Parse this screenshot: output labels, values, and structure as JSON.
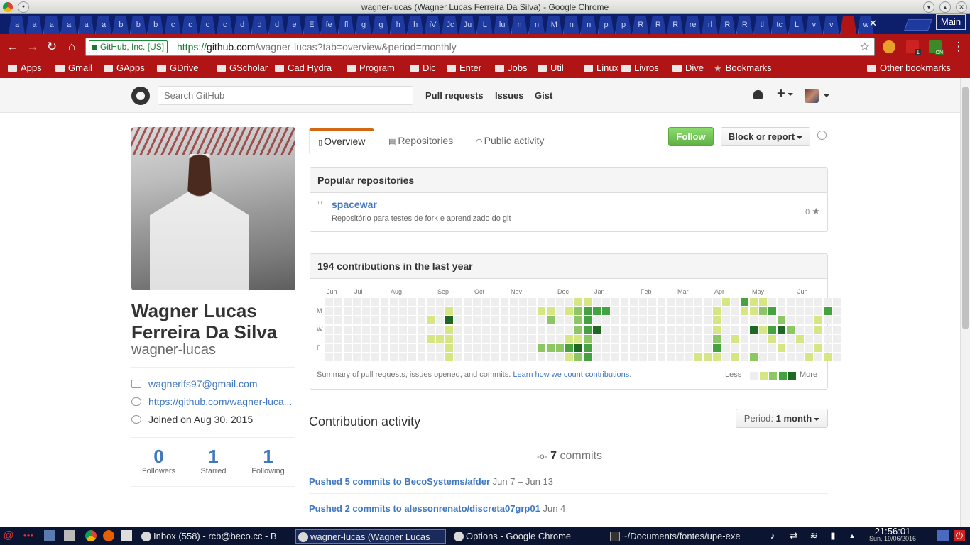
{
  "window": {
    "title": "wagner-lucas (Wagner Lucas Ferreira Da Silva) - Google Chrome",
    "workspace": "Main"
  },
  "tabs": [
    "a",
    "a",
    "a",
    "a",
    "a",
    "a",
    "b",
    "b",
    "b",
    "c",
    "c",
    "c",
    "c",
    "d",
    "d",
    "d",
    "e",
    "E",
    "fe",
    "fl",
    "g",
    "g",
    "h",
    "h",
    "iV",
    "Jc",
    "Ju",
    "L",
    "lu",
    "n",
    "n",
    "M",
    "n",
    "n",
    "p",
    "p",
    "R",
    "R",
    "R",
    "re",
    "rl",
    "R",
    "R",
    "tl",
    "tc",
    "L",
    "v",
    "v",
    "",
    "w"
  ],
  "omnibox": {
    "security_label": "GitHub, Inc. [US]",
    "url_prefix": "https://",
    "url_host": "github.com",
    "url_path": "/wagner-lucas?tab=overview&period=monthly"
  },
  "extensions": {
    "badge1": "1",
    "badge2": "ON"
  },
  "bookmarks": [
    {
      "label": "Apps",
      "icon": "apps-icon"
    },
    {
      "label": "Gmail",
      "icon": "gmail-icon"
    },
    {
      "label": "GApps",
      "icon": "google-icon"
    },
    {
      "label": "GDrive",
      "icon": "drive-icon"
    },
    {
      "label": "GScholar",
      "icon": "scholar-icon"
    },
    {
      "label": "Cad Hydra",
      "icon": "drive-icon"
    },
    {
      "label": "Program",
      "icon": "folder-icon"
    },
    {
      "label": "Dic",
      "icon": "folder-icon"
    },
    {
      "label": "Enter",
      "icon": "folder-icon"
    },
    {
      "label": "Jobs",
      "icon": "folder-icon"
    },
    {
      "label": "Util",
      "icon": "folder-icon"
    },
    {
      "label": "Linux",
      "icon": "folder-icon"
    },
    {
      "label": "Livros",
      "icon": "folder-icon"
    },
    {
      "label": "Dive",
      "icon": "folder-icon"
    },
    {
      "label": "Bookmarks",
      "icon": "star-icon"
    }
  ],
  "other_bookmarks": "Other bookmarks",
  "github": {
    "search_placeholder": "Search GitHub",
    "nav": [
      "Pull requests",
      "Issues",
      "Gist"
    ]
  },
  "profile": {
    "fullname": "Wagner Lucas Ferreira Da Silva",
    "username": "wagner-lucas",
    "email": "wagnerlfs97@gmail.com",
    "website": "https://github.com/wagner-luca...",
    "joined": "Joined on Aug 30, 2015",
    "stats": [
      {
        "value": "0",
        "label": "Followers"
      },
      {
        "value": "1",
        "label": "Starred"
      },
      {
        "value": "1",
        "label": "Following"
      }
    ]
  },
  "profile_tabs": [
    "Overview",
    "Repositories",
    "Public activity"
  ],
  "actions": {
    "follow": "Follow",
    "block": "Block or report"
  },
  "popular": {
    "title": "Popular repositories",
    "repo": {
      "name": "spacewar",
      "description": "Repositório para testes de fork e aprendizado do git",
      "stars": "0"
    }
  },
  "contributions": {
    "title": "194 contributions in the last year",
    "months": [
      "Jun",
      "Jul",
      "Aug",
      "Sep",
      "Oct",
      "Nov",
      "Dec",
      "Jan",
      "Feb",
      "Mar",
      "Apr",
      "May",
      "Jun"
    ],
    "days": [
      "M",
      "W",
      "F"
    ],
    "summary": "Summary of pull requests, issues opened, and commits.",
    "learn_link": "Learn how we count contributions.",
    "less": "Less",
    "more": "More",
    "colors": [
      "#eeeeee",
      "#d6e685",
      "#8cc665",
      "#44a340",
      "#1e6823"
    ],
    "levels": [
      [
        0,
        0,
        0,
        0,
        0,
        0,
        0
      ],
      [
        0,
        0,
        0,
        0,
        0,
        0,
        0
      ],
      [
        0,
        0,
        0,
        0,
        0,
        0,
        0
      ],
      [
        0,
        0,
        0,
        0,
        0,
        0,
        0
      ],
      [
        0,
        0,
        0,
        0,
        0,
        0,
        0
      ],
      [
        0,
        0,
        0,
        0,
        0,
        0,
        0
      ],
      [
        0,
        0,
        0,
        0,
        0,
        0,
        0
      ],
      [
        0,
        0,
        0,
        0,
        0,
        0,
        0
      ],
      [
        0,
        0,
        0,
        0,
        0,
        0,
        0
      ],
      [
        0,
        0,
        0,
        0,
        0,
        0,
        0
      ],
      [
        0,
        0,
        0,
        0,
        0,
        0,
        0
      ],
      [
        0,
        0,
        1,
        0,
        1,
        0,
        0
      ],
      [
        0,
        0,
        0,
        0,
        1,
        0,
        0
      ],
      [
        0,
        1,
        4,
        1,
        1,
        1,
        1
      ],
      [
        0,
        0,
        0,
        0,
        0,
        0,
        0
      ],
      [
        0,
        0,
        0,
        0,
        0,
        0,
        0
      ],
      [
        0,
        0,
        0,
        0,
        0,
        0,
        0
      ],
      [
        0,
        0,
        0,
        0,
        0,
        0,
        0
      ],
      [
        0,
        0,
        0,
        0,
        0,
        0,
        0
      ],
      [
        0,
        0,
        0,
        0,
        0,
        0,
        0
      ],
      [
        0,
        0,
        0,
        0,
        0,
        0,
        0
      ],
      [
        0,
        0,
        0,
        0,
        0,
        0,
        0
      ],
      [
        0,
        0,
        0,
        0,
        0,
        0,
        0
      ],
      [
        0,
        1,
        0,
        0,
        0,
        2,
        0
      ],
      [
        0,
        1,
        2,
        0,
        0,
        2,
        0
      ],
      [
        0,
        0,
        0,
        0,
        0,
        2,
        0
      ],
      [
        0,
        1,
        0,
        0,
        1,
        3,
        1
      ],
      [
        1,
        2,
        2,
        2,
        1,
        4,
        2
      ],
      [
        1,
        3,
        3,
        3,
        2,
        3,
        3
      ],
      [
        0,
        3,
        0,
        4,
        0,
        0,
        0
      ],
      [
        0,
        3,
        0,
        0,
        0,
        0,
        0
      ],
      [
        0,
        0,
        0,
        0,
        0,
        0,
        0
      ],
      [
        0,
        0,
        0,
        0,
        0,
        0,
        0
      ],
      [
        0,
        0,
        0,
        0,
        0,
        0,
        0
      ],
      [
        0,
        0,
        0,
        0,
        0,
        0,
        0
      ],
      [
        0,
        0,
        0,
        0,
        0,
        0,
        0
      ],
      [
        0,
        0,
        0,
        0,
        0,
        0,
        0
      ],
      [
        0,
        0,
        0,
        0,
        0,
        0,
        0
      ],
      [
        0,
        0,
        0,
        0,
        0,
        0,
        0
      ],
      [
        0,
        0,
        0,
        0,
        0,
        0,
        0
      ],
      [
        0,
        0,
        0,
        0,
        0,
        0,
        1
      ],
      [
        0,
        0,
        0,
        0,
        0,
        0,
        1
      ],
      [
        0,
        1,
        1,
        1,
        2,
        3,
        1
      ],
      [
        1,
        0,
        0,
        0,
        0,
        0,
        0
      ],
      [
        0,
        0,
        0,
        0,
        1,
        0,
        1
      ],
      [
        3,
        1,
        0,
        0,
        0,
        0,
        0
      ],
      [
        1,
        1,
        0,
        4,
        0,
        0,
        2
      ],
      [
        1,
        2,
        0,
        1,
        0,
        0,
        0
      ],
      [
        0,
        3,
        0,
        3,
        1,
        0,
        0
      ],
      [
        0,
        0,
        2,
        4,
        0,
        1,
        0
      ],
      [
        0,
        0,
        0,
        2,
        0,
        0,
        0
      ],
      [
        0,
        0,
        0,
        0,
        1,
        0,
        0
      ],
      [
        0,
        0,
        0,
        0,
        0,
        0,
        1
      ],
      [
        0,
        0,
        1,
        1,
        0,
        1,
        0
      ],
      [
        0,
        3,
        0,
        0,
        0,
        0,
        1
      ],
      [
        0,
        0,
        0,
        0,
        0,
        0,
        0
      ]
    ]
  },
  "activity": {
    "title": "Contribution activity",
    "period_label": "Period:",
    "period_value": "1 month",
    "commits_count": "7",
    "commits_word": "commits",
    "pushes": [
      {
        "text": "Pushed 5 commits to BecoSystems/afder",
        "date": "Jun 7 – Jun 13"
      },
      {
        "text": "Pushed 2 commits to alessonrenato/discreta07grp01",
        "date": "Jun 4"
      }
    ]
  },
  "taskbar": {
    "items": [
      {
        "label": "Inbox (558) - rcb@beco.cc - B",
        "icon": "chrome-icon"
      },
      {
        "label": "wagner-lucas (Wagner Lucas",
        "icon": "chrome-icon"
      },
      {
        "label": "Options - Google Chrome",
        "icon": "chrome-icon"
      },
      {
        "label": "~/Documents/fontes/upe-exe",
        "icon": "terminal-icon"
      }
    ],
    "time": "21:56:01",
    "date": "Sun, 19/06/2016"
  }
}
